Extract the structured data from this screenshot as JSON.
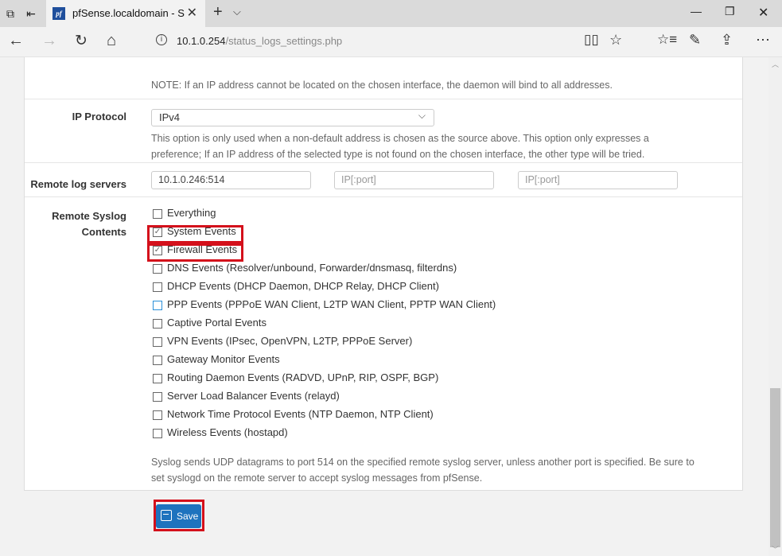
{
  "browser": {
    "tab_title": "pfSense.localdomain - S",
    "favicon_text": "pf",
    "url_host": "10.1.0.254",
    "url_path": "/status_logs_settings.php"
  },
  "form": {
    "source_note": "NOTE: If an IP address cannot be located on the chosen interface, the daemon will bind to all addresses.",
    "ip_protocol": {
      "label": "IP Protocol",
      "selected": "IPv4",
      "help_line1": "This option is only used when a non-default address is chosen as the source above. This option only expresses a",
      "help_line2": "preference; If an IP address of the selected type is not found on the chosen interface, the other type will be tried."
    },
    "remote_servers": {
      "label": "Remote log servers",
      "server1_value": "10.1.0.246:514",
      "server2_placeholder": "IP[:port]",
      "server3_placeholder": "IP[:port]"
    },
    "syslog_contents": {
      "label_line1": "Remote Syslog",
      "label_line2": "Contents",
      "items": [
        {
          "label": "Everything",
          "checked": false
        },
        {
          "label": "System Events",
          "checked": true
        },
        {
          "label": "Firewall Events",
          "checked": true
        },
        {
          "label": "DNS Events (Resolver/unbound, Forwarder/dnsmasq, filterdns)",
          "checked": false
        },
        {
          "label": "DHCP Events (DHCP Daemon, DHCP Relay, DHCP Client)",
          "checked": false
        },
        {
          "label": "PPP Events (PPPoE WAN Client, L2TP WAN Client, PPTP WAN Client)",
          "checked": false
        },
        {
          "label": "Captive Portal Events",
          "checked": false
        },
        {
          "label": "VPN Events (IPsec, OpenVPN, L2TP, PPPoE Server)",
          "checked": false
        },
        {
          "label": "Gateway Monitor Events",
          "checked": false
        },
        {
          "label": "Routing Daemon Events (RADVD, UPnP, RIP, OSPF, BGP)",
          "checked": false
        },
        {
          "label": "Server Load Balancer Events (relayd)",
          "checked": false
        },
        {
          "label": "Network Time Protocol Events (NTP Daemon, NTP Client)",
          "checked": false
        },
        {
          "label": "Wireless Events (hostapd)",
          "checked": false
        }
      ],
      "help_line1": "Syslog sends UDP datagrams to port 514 on the specified remote syslog server, unless another port is specified. Be sure to",
      "help_line2": "set syslogd on the remote server to accept syslog messages from pfSense."
    },
    "save_label": "Save"
  },
  "colors": {
    "accent": "#1e73be",
    "highlight": "#d4101b"
  }
}
